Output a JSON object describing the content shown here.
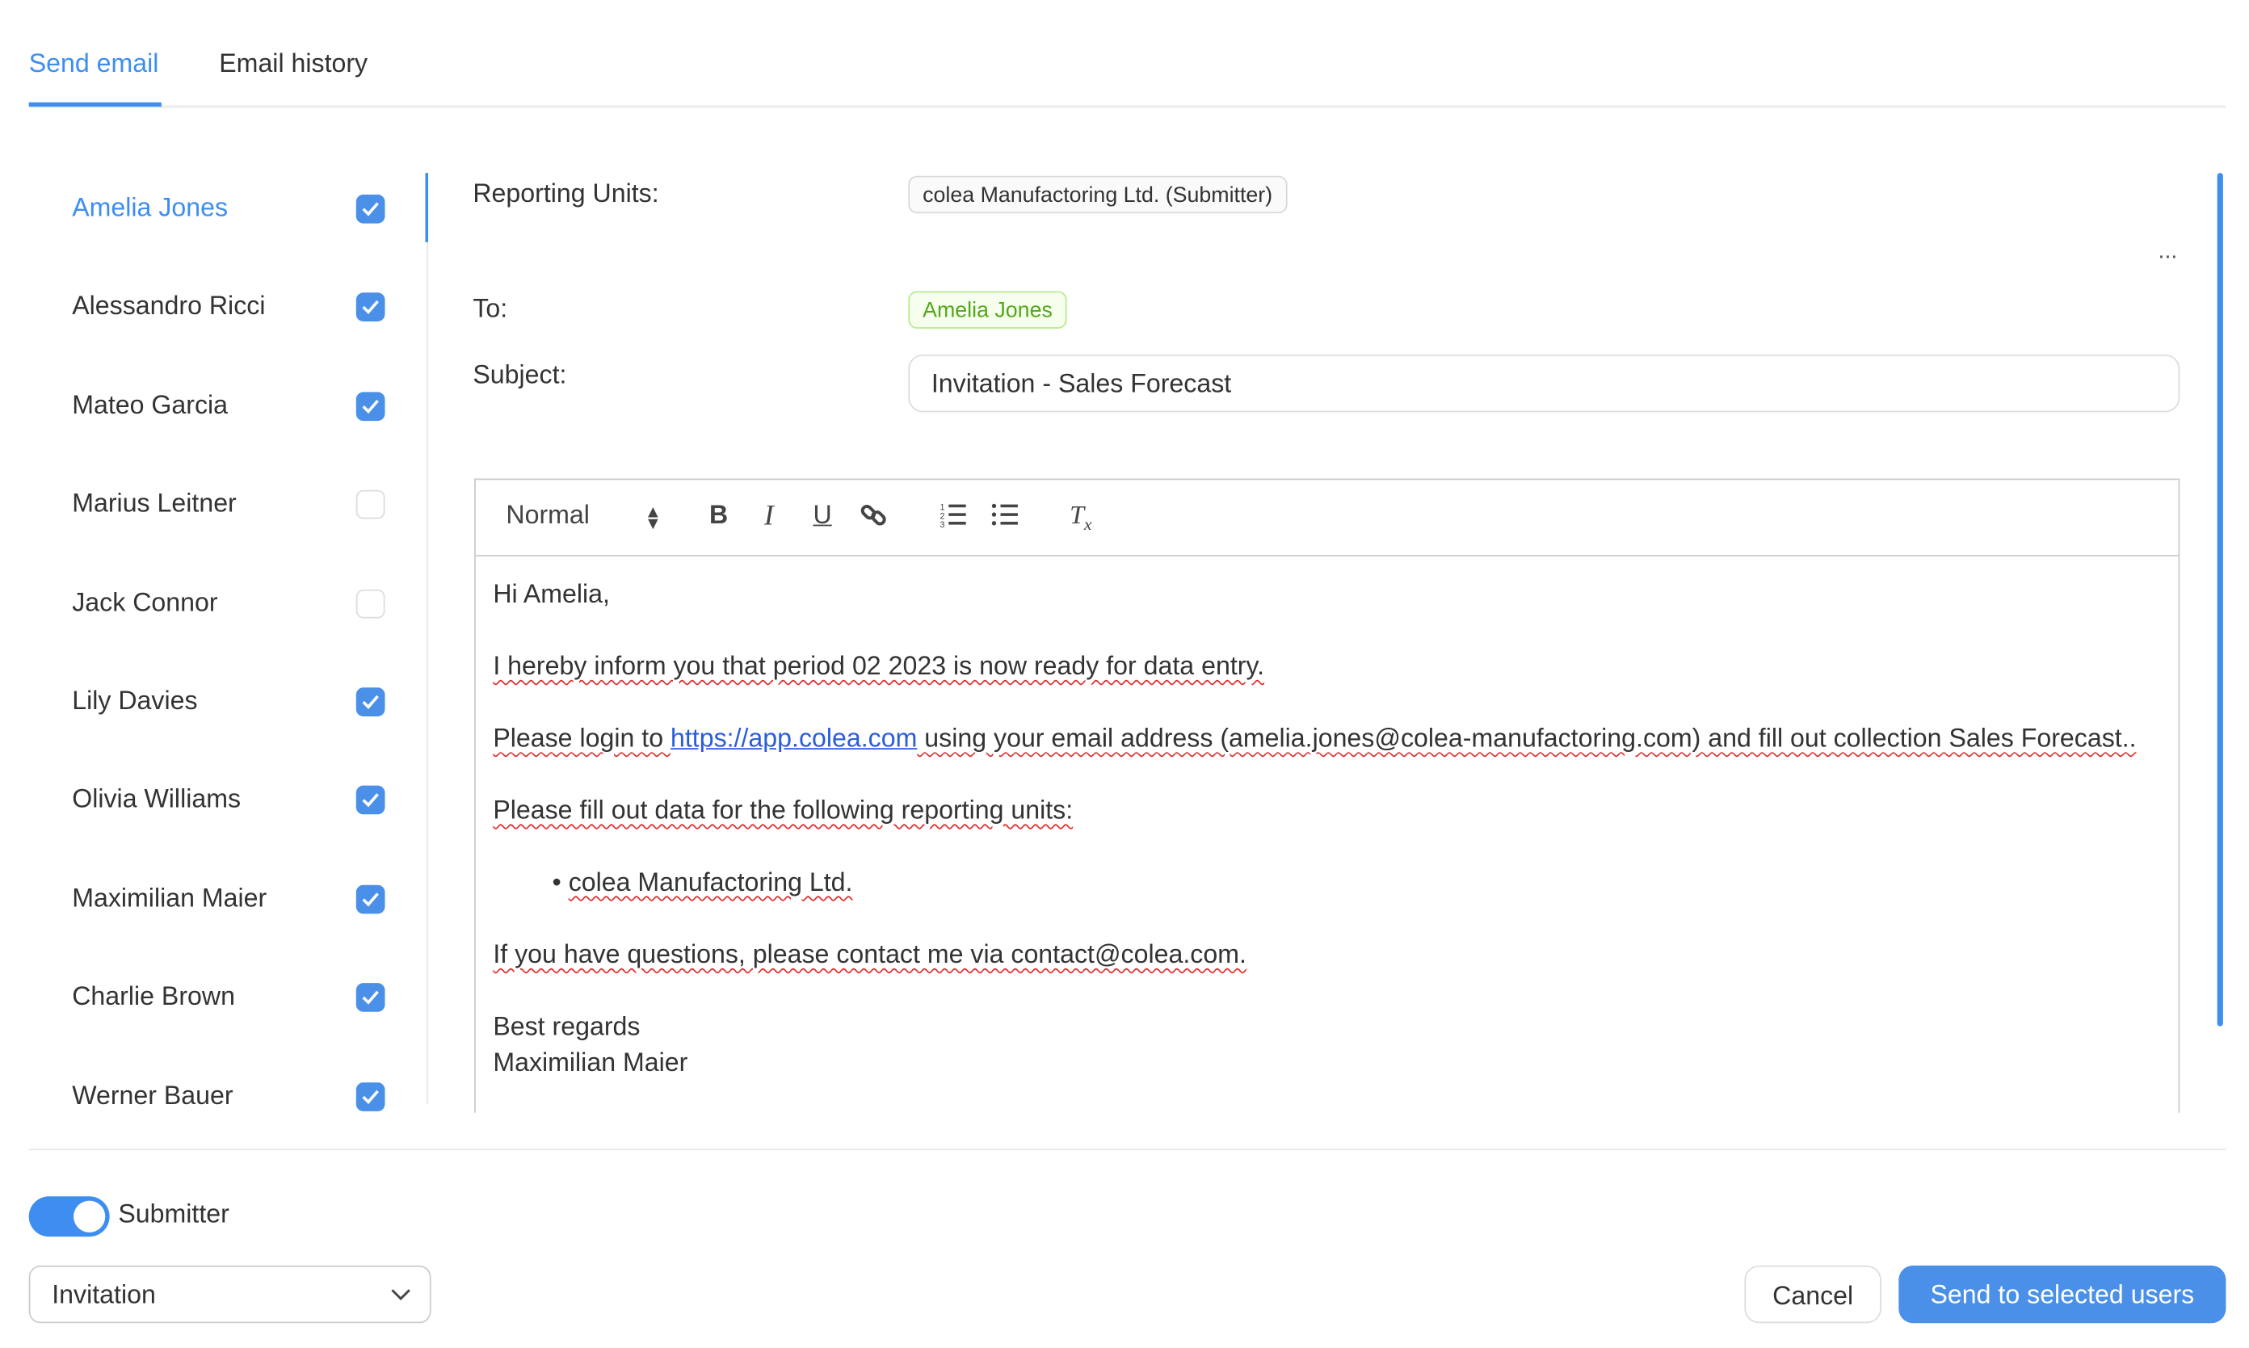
{
  "tabs": [
    {
      "label": "Send email",
      "active": true
    },
    {
      "label": "Email history",
      "active": false
    }
  ],
  "users": [
    {
      "name": "Amelia Jones",
      "checked": true,
      "active": true
    },
    {
      "name": "Alessandro Ricci",
      "checked": true
    },
    {
      "name": "Mateo Garcia",
      "checked": true
    },
    {
      "name": "Marius Leitner",
      "checked": false
    },
    {
      "name": "Jack Connor",
      "checked": false
    },
    {
      "name": "Lily Davies",
      "checked": true
    },
    {
      "name": "Olivia Williams",
      "checked": true
    },
    {
      "name": "Maximilian Maier",
      "checked": true
    },
    {
      "name": "Charlie Brown",
      "checked": true
    },
    {
      "name": "Werner Bauer",
      "checked": true
    }
  ],
  "form": {
    "reporting_units_label": "Reporting Units:",
    "reporting_unit_chip": "colea Manufactoring Ltd. (Submitter)",
    "more": "...",
    "to_label": "To:",
    "to_chip": "Amelia Jones",
    "subject_label": "Subject:",
    "subject_value": "Invitation - Sales Forecast"
  },
  "toolbar": {
    "format": "Normal"
  },
  "email_body": {
    "greeting": "Hi Amelia,",
    "line1": "I hereby inform you that period 02 2023 is now ready for data entry.",
    "line2_a": "Please login to ",
    "link": "https://app.colea.com",
    "line2_b": " using your email address (amelia.jones@colea-manufactoring.com) and fill out collection Sales Forecast..",
    "line3": "Please fill out data for the following reporting units:",
    "bullet": "colea Manufactoring Ltd.",
    "line4": "If you have questions, please contact me via contact@colea.com.",
    "closing": "Best regards",
    "signature": "Maximilian Maier"
  },
  "footer": {
    "toggle_label": "Submitter",
    "toggle_on": true,
    "template_value": "Invitation",
    "cancel": "Cancel",
    "send": "Send to selected users"
  },
  "colors": {
    "accent": "#3d8ef0",
    "chip_green": "#52a818"
  }
}
